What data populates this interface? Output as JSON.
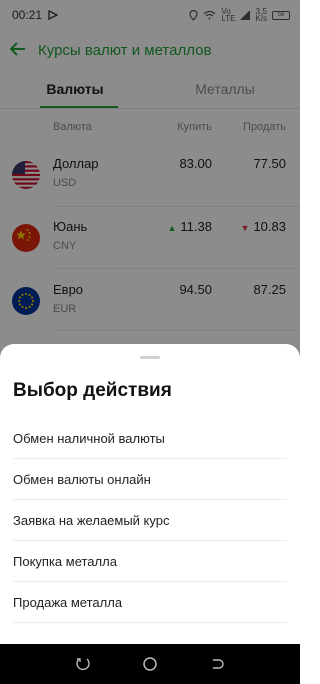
{
  "status": {
    "time": "00:21",
    "volte": "Vo",
    "lte": "LTE",
    "speed": "3,5",
    "speed_unit": "K/s",
    "battery": "58"
  },
  "header": {
    "title": "Курсы валют и металлов"
  },
  "tabs": [
    {
      "label": "Валюты",
      "active": true
    },
    {
      "label": "Металлы",
      "active": false
    }
  ],
  "columns": {
    "currency": "Валюта",
    "buy": "Купить",
    "sell": "Продать"
  },
  "rates": [
    {
      "name": "Доллар",
      "code": "USD",
      "buy": "83.00",
      "sell": "77.50",
      "buy_trend": "",
      "sell_trend": ""
    },
    {
      "name": "Юань",
      "code": "CNY",
      "buy": "11.38",
      "sell": "10.83",
      "buy_trend": "up",
      "sell_trend": "down"
    },
    {
      "name": "Евро",
      "code": "EUR",
      "buy": "94.50",
      "sell": "87.25",
      "buy_trend": "",
      "sell_trend": ""
    }
  ],
  "sheet": {
    "title": "Выбор действия",
    "actions": [
      "Обмен наличной валюты",
      "Обмен валюты онлайн",
      "Заявка на желаемый курс",
      "Покупка металла",
      "Продажа металла"
    ]
  },
  "colors": {
    "accent": "#21a038",
    "down": "#e0344c"
  }
}
